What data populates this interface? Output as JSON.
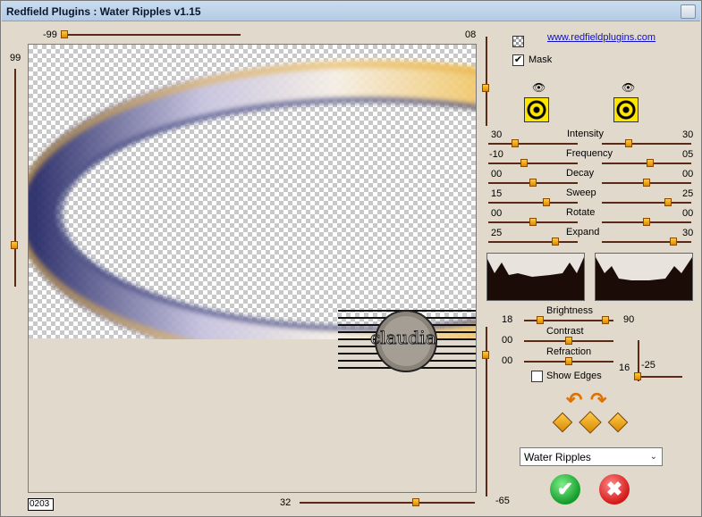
{
  "window": {
    "title": "Redfield Plugins : Water Ripples v1.15"
  },
  "link": {
    "text": "www.redfieldplugins.com"
  },
  "mask": {
    "label": "Mask",
    "checked": true
  },
  "preview": {
    "top_left_value": "-99",
    "top_right_value": "08",
    "left_value": "99",
    "bottom_value": "32",
    "bottom_right_value": "-65",
    "coord_readout": "0203"
  },
  "sliders": {
    "intensity": {
      "label": "Intensity",
      "left": "30",
      "right": "30"
    },
    "frequency": {
      "label": "Frequency",
      "left": "-10",
      "right": "05"
    },
    "decay": {
      "label": "Decay",
      "left": "00",
      "right": "00"
    },
    "sweep": {
      "label": "Sweep",
      "left": "15",
      "right": "25"
    },
    "rotate": {
      "label": "Rotate",
      "left": "00",
      "right": "00"
    },
    "expand": {
      "label": "Expand",
      "left": "25",
      "right": "30"
    }
  },
  "adjust": {
    "brightness": {
      "label": "Brightness",
      "left": "18",
      "right": "90"
    },
    "contrast": {
      "label": "Contrast",
      "left": "00"
    },
    "refraction": {
      "label": "Refraction",
      "left": "00"
    },
    "show_edges": {
      "label": "Show Edges",
      "checked": false
    },
    "v_value": "16",
    "h_value": "-25"
  },
  "preset": {
    "selected": "Water Ripples"
  },
  "watermark": {
    "text": "claudia"
  },
  "icons": {
    "eye_left": "eye-icon",
    "eye_right": "eye-icon",
    "ok": "check-icon",
    "cancel": "close-icon"
  },
  "colors": {
    "slider_track": "#5b2a17",
    "knob": "#f0a000",
    "ok": "#1ea83a",
    "cancel": "#d41818"
  }
}
